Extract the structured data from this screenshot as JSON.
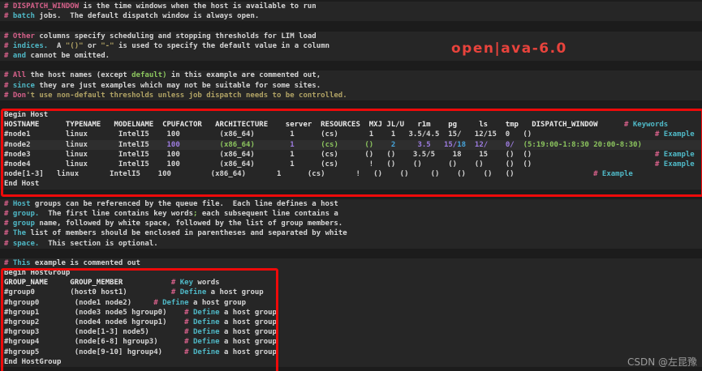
{
  "app": {
    "type": "terminal-code-editor-screenshot",
    "file_kind": "openlava lsb.hosts configuration"
  },
  "colors": {
    "page_bg": "#1c1c1c",
    "line_band_bg": "#262626",
    "current_line_bg": "#2e2e2e",
    "comment_pink": "#d6608a",
    "comment_cyan": "#4fb8c6",
    "text_white": "#d6d6d6",
    "string_olive": "#b0a264",
    "green": "#8cc55e",
    "violet": "#9d7ce0",
    "blue": "#46a4da",
    "header_white": "#eaeaea",
    "keyword_white": "#dcdcdc",
    "annotation_red": "#ee0a0a",
    "watermark_red": "#e8433c",
    "csdn_gray": "#9b9b9b"
  },
  "watermarks": {
    "overlay_text": "open|ava-6.0",
    "credit_text": "CSDN @左昆豫"
  },
  "editor": {
    "lines": [
      {
        "s": [
          [
            "# DISPATCH_WINDOW",
            "p"
          ],
          [
            " is the time windows when the host is available to run",
            "w"
          ]
        ]
      },
      {
        "s": [
          [
            "#",
            "p"
          ],
          [
            " batch",
            "c"
          ],
          [
            " jobs.  The default dispatch window is always open.",
            "w"
          ]
        ]
      },
      {
        "s": []
      },
      {
        "s": [
          [
            "# Other",
            "p"
          ],
          [
            " columns specify scheduling and stopping thresholds for LIM load",
            "w"
          ]
        ]
      },
      {
        "s": [
          [
            "#",
            "p"
          ],
          [
            " indices.",
            "c"
          ],
          [
            "  A ",
            "w"
          ],
          [
            "\"()\"",
            "o"
          ],
          [
            " or ",
            "w"
          ],
          [
            "\"-\"",
            "o"
          ],
          [
            " is used to specify the default value in a column",
            "w"
          ]
        ]
      },
      {
        "s": [
          [
            "#",
            "p"
          ],
          [
            " and",
            "c"
          ],
          [
            " cannot be omitted.",
            "w"
          ]
        ]
      },
      {
        "s": []
      },
      {
        "s": [
          [
            "# All",
            "p"
          ],
          [
            " the host names (except ",
            "w"
          ],
          [
            "default)",
            "g"
          ],
          [
            " in this example are commented out,",
            "w"
          ]
        ]
      },
      {
        "s": [
          [
            "#",
            "p"
          ],
          [
            " since",
            "c"
          ],
          [
            " they are just examples which may not be suitable for some sites.",
            "w"
          ]
        ]
      },
      {
        "s": [
          [
            "# Don",
            "p"
          ],
          [
            "'t use non-default thresholds unless job dispatch needs to be controlled.",
            "o"
          ]
        ]
      },
      {
        "s": []
      },
      {
        "s": [
          [
            "Begin Host",
            "k"
          ]
        ]
      },
      {
        "s": [
          [
            "HOSTNAME      TYPENAME   MODELNAME  CPUFACTOR   ARCHITECTURE    server  RESOURCES  MXJ JL/U   r1m    pg     ls    tmp   DISPATCH_WINDOW      ",
            "h"
          ],
          [
            "# ",
            "p"
          ],
          [
            "Keywords",
            "c"
          ]
        ]
      },
      {
        "s": [
          [
            "#node1        linux       IntelI5    100         (x86_64)        1      (cs)       1    1   3.5/4.5  15/   12/15  0   ()                            ",
            "w"
          ],
          [
            "# ",
            "p"
          ],
          [
            "Example",
            "c"
          ]
        ]
      },
      {
        "cur": true,
        "s": [
          [
            "#node2        linux       IntelI5    ",
            "w"
          ],
          [
            "100",
            "v"
          ],
          [
            "         ",
            "w"
          ],
          [
            "(x86_64)",
            "g"
          ],
          [
            "        ",
            "w"
          ],
          [
            "1",
            "v"
          ],
          [
            "      ",
            "w"
          ],
          [
            "(cs)",
            "g"
          ],
          [
            "      ",
            "w"
          ],
          [
            "()",
            "g"
          ],
          [
            "    ",
            "w"
          ],
          [
            "2",
            "b"
          ],
          [
            "     ",
            "w"
          ],
          [
            "3.5",
            "v"
          ],
          [
            "   ",
            "w"
          ],
          [
            "15/",
            "v"
          ],
          [
            "18",
            "b"
          ],
          [
            "  ",
            "w"
          ],
          [
            "12/",
            "v"
          ],
          [
            "    ",
            "w"
          ],
          [
            "0/",
            "v"
          ],
          [
            "  ",
            "w"
          ],
          [
            "(5:19:00-1:8:30 20:00-8:30)",
            "g"
          ]
        ]
      },
      {
        "s": [
          [
            "#node3        linux       IntelI5    100         (x86_64)        1      (cs)      ()   ()    3.5/5    18    15    ()  ()                            ",
            "w"
          ],
          [
            "# ",
            "p"
          ],
          [
            "Example",
            "c"
          ]
        ]
      },
      {
        "s": [
          [
            "#node4        linux       IntelI5    100         (x86_64)        1      (cs)       !   ()    ()      ()    ()     ()  ()                            ",
            "w"
          ],
          [
            "# ",
            "p"
          ],
          [
            "Example",
            "c"
          ]
        ]
      },
      {
        "s": [
          [
            "node[1-3]   linux       IntelI5    100         (x86_64)       1      (cs)       !   ()    ()     ()    ()    ()   ()                  ",
            "w"
          ],
          [
            "# ",
            "p"
          ],
          [
            "Example",
            "c"
          ]
        ]
      },
      {
        "s": [
          [
            "End Host",
            "k"
          ]
        ]
      },
      {
        "s": []
      },
      {
        "s": [
          [
            "#",
            "p"
          ],
          [
            " Host",
            "c"
          ],
          [
            " groups can be referenced by the queue file.  Each line defines a host",
            "w"
          ]
        ]
      },
      {
        "s": [
          [
            "#",
            "p"
          ],
          [
            " group.",
            "c"
          ],
          [
            "  The first line contains key words",
            "w"
          ],
          [
            ";",
            "g"
          ],
          [
            " each subsequent line contains a",
            "w"
          ]
        ]
      },
      {
        "s": [
          [
            "#",
            "p"
          ],
          [
            " group",
            "c"
          ],
          [
            " name, followed by white space, followed by the list of group members.",
            "w"
          ]
        ]
      },
      {
        "s": [
          [
            "#",
            "p"
          ],
          [
            " The",
            "c"
          ],
          [
            " list of members should be enclosed in parentheses and separated by white",
            "w"
          ]
        ]
      },
      {
        "s": [
          [
            "#",
            "p"
          ],
          [
            " space.",
            "c"
          ],
          [
            "  This section is optional.",
            "w"
          ]
        ]
      },
      {
        "s": []
      },
      {
        "s": [
          [
            "#",
            "p"
          ],
          [
            " This",
            "c"
          ],
          [
            " example is commented out",
            "w"
          ]
        ]
      },
      {
        "s": [
          [
            "Begin HostGroup",
            "k"
          ]
        ]
      },
      {
        "s": [
          [
            "GROUP_NAME     GROUP_MEMBER           ",
            "h"
          ],
          [
            "# ",
            "p"
          ],
          [
            "Key",
            "c"
          ],
          [
            " words",
            "w"
          ]
        ]
      },
      {
        "s": [
          [
            "#group0        (host0 host1)          ",
            "w"
          ],
          [
            "# ",
            "p"
          ],
          [
            "Define",
            "c"
          ],
          [
            " a host group",
            "w"
          ]
        ]
      },
      {
        "s": [
          [
            "#hgroup0        (node1 node2)     ",
            "w"
          ],
          [
            "# ",
            "p"
          ],
          [
            "Define",
            "c"
          ],
          [
            " a host group",
            "w"
          ]
        ]
      },
      {
        "s": [
          [
            "#hgroup1        (node3 node5 hgroup0)    ",
            "w"
          ],
          [
            "# ",
            "p"
          ],
          [
            "Define",
            "c"
          ],
          [
            " a host group",
            "w"
          ]
        ]
      },
      {
        "s": [
          [
            "#hgroup2        (node4 node6 hgroup1)    ",
            "w"
          ],
          [
            "# ",
            "p"
          ],
          [
            "Define",
            "c"
          ],
          [
            " a host group",
            "w"
          ]
        ]
      },
      {
        "s": [
          [
            "#hgroup3        (node[1-3] node5)        ",
            "w"
          ],
          [
            "# ",
            "p"
          ],
          [
            "Define",
            "c"
          ],
          [
            " a host group",
            "w"
          ]
        ]
      },
      {
        "s": [
          [
            "#hgroup4        (node[6-8] hgroup3)      ",
            "w"
          ],
          [
            "# ",
            "p"
          ],
          [
            "Define",
            "c"
          ],
          [
            " a host group",
            "w"
          ]
        ]
      },
      {
        "s": [
          [
            "#hgroup5        (node[9-10] hgroup4)     ",
            "w"
          ],
          [
            "# ",
            "p"
          ],
          [
            "Define",
            "c"
          ],
          [
            " a host group",
            "w"
          ]
        ]
      },
      {
        "s": [
          [
            "End HostGroup",
            "k"
          ]
        ]
      }
    ]
  },
  "annotations": {
    "host_section_box": "red rectangle around Begin Host ... End Host",
    "hostgroup_section_box": "red rectangle around Begin HostGroup ... End HostGroup"
  }
}
